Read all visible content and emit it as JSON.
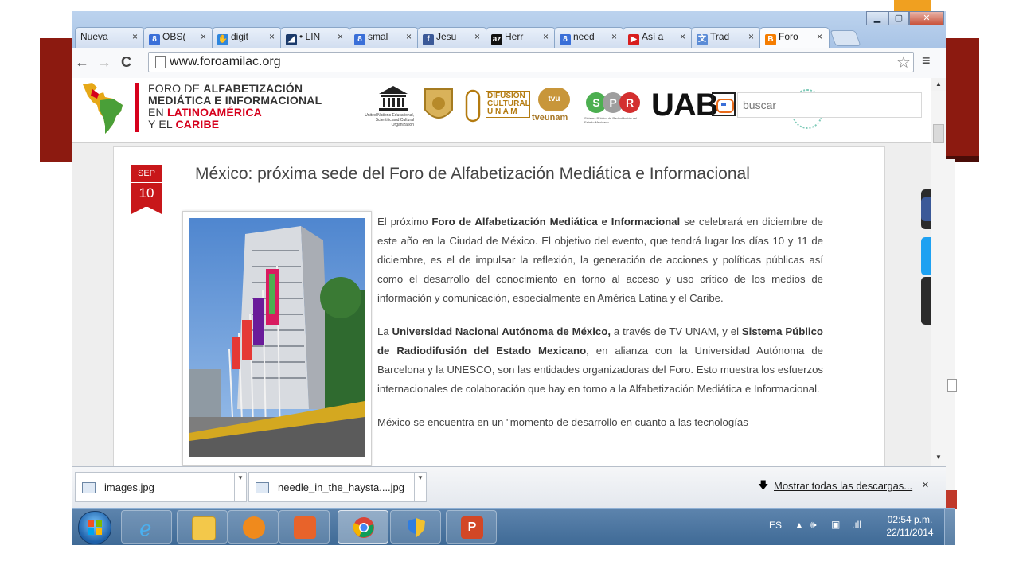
{
  "colors": {
    "accent_red": "#d6001c",
    "slide_red": "#8c1a10",
    "chrome_blue": "#bcd3ee"
  },
  "browser": {
    "tabs": [
      {
        "title": "Nueva p",
        "icon": "blank-page-icon"
      },
      {
        "title": "OBS(",
        "icon": "google-8-icon"
      },
      {
        "title": "digit",
        "icon": "blogger-hand-icon"
      },
      {
        "title": "• LIN",
        "icon": "lin-icon"
      },
      {
        "title": "smal",
        "icon": "google-8-icon"
      },
      {
        "title": "Jesu",
        "icon": "facebook-icon"
      },
      {
        "title": "Herr",
        "icon": "az-icon"
      },
      {
        "title": "need",
        "icon": "google-8-icon"
      },
      {
        "title": "Así a",
        "icon": "youtube-icon"
      },
      {
        "title": "Trad",
        "icon": "translate-icon"
      },
      {
        "title": "Foro",
        "icon": "blogger-icon"
      }
    ],
    "tab_close": "×",
    "url": "www.foroamilac.org",
    "window_controls": {
      "minimize": "▁",
      "maximize": "▢",
      "close": "✕"
    }
  },
  "site": {
    "title_line1_a": "FORO DE ",
    "title_line1_b": "ALFABETIZACIÓN",
    "title_line2": "MEDIÁTICA E INFORMACIONAL",
    "title_line3_a": "EN ",
    "title_line3_b": "LATINOAMÉRICA",
    "title_line4_a": "Y EL ",
    "title_line4_b": "CARIBE",
    "unesco_caption": "United Nations Educational, Scientific and Cultural Organization",
    "difusion_lines": [
      "DIFUSION",
      "CULTURAL",
      "U N A M"
    ],
    "tvunam_label": "tveunam",
    "tvunam_badge": "tvu",
    "spr_letters": [
      "S",
      "P",
      "R"
    ],
    "spr_caption": "Sistema Público de Radiodifusión del Estado Mexicano",
    "uab_label": "UAB",
    "search_placeholder": "buscar"
  },
  "article": {
    "month": "SEP",
    "day": "10",
    "title": "México: próxima sede del Foro de Alfabetización Mediática e Informacional",
    "p1_a": "El próximo ",
    "p1_b": "Foro de Alfabetización Mediática e Informacional",
    "p1_c": " se celebrará en diciembre de este año en la Ciudad de México. El objetivo del evento, que tendrá lugar los días 10 y 11 de diciembre, es el de impulsar la reflexión, la generación de acciones y políticas públicas así como el desarrollo del conocimiento en torno al acceso y uso crítico de los medios de información y comunicación, especialmente en América Latina y el Caribe.",
    "p2_a": "La ",
    "p2_b": "Universidad Nacional Autónoma de México,",
    "p2_c": " a través de TV UNAM, y el ",
    "p2_d": "Sistema Público de Radiodifusión del Estado Mexicano",
    "p2_e": ", en alianza con la Universidad Autónoma de Barcelona y la UNESCO, son las entidades organizadoras del Foro. Esto muestra los esfuerzos internacionales de colaboración que hay en torno a la Alfabetización Mediática e Informacional.",
    "p3": "México se encuentra en un \"momento de desarrollo en cuanto a las tecnologías"
  },
  "downloads": {
    "items": [
      {
        "name": "images.jpg"
      },
      {
        "name": "needle_in_the_haysta....jpg"
      }
    ],
    "show_all": "Mostrar todas las descargas...",
    "close": "×"
  },
  "taskbar": {
    "language": "ES",
    "time": "02:54 p.m.",
    "date": "22/11/2014"
  }
}
